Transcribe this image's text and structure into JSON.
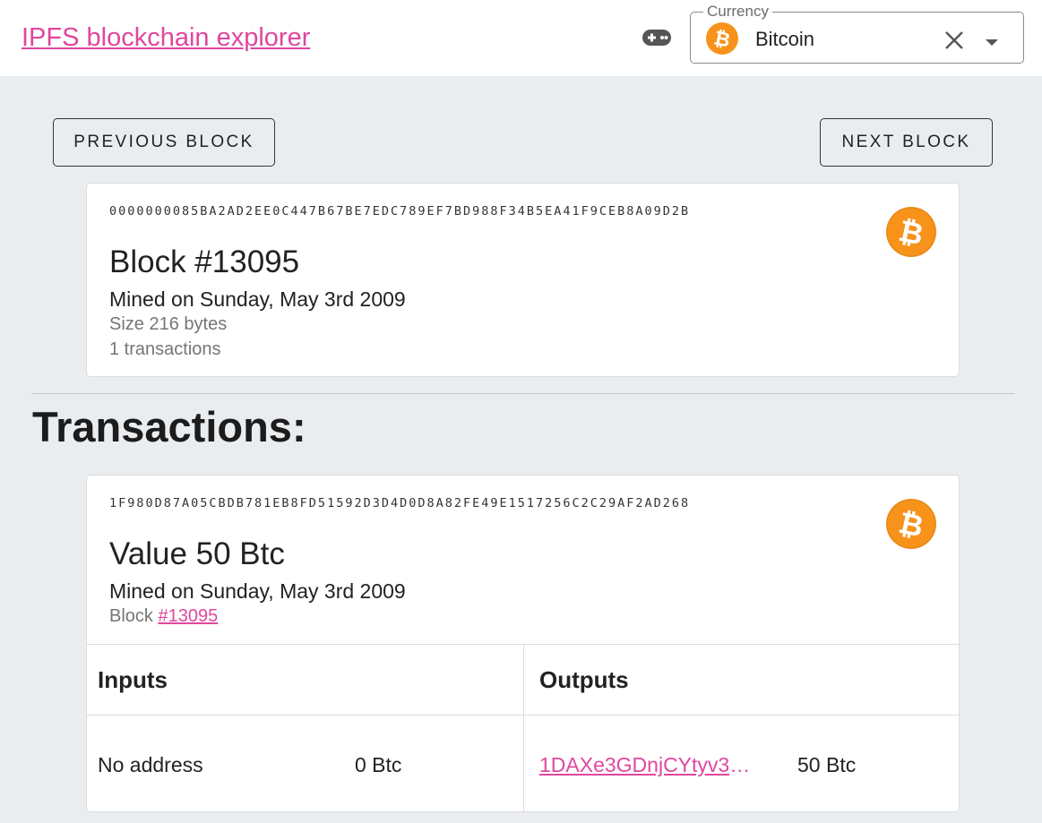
{
  "header": {
    "brand": "IPFS blockchain explorer",
    "game_icon": "gamepad-icon",
    "currency": {
      "legend": "Currency",
      "selected": "Bitcoin",
      "coin_icon": "bitcoin-icon",
      "clear_icon": "close-icon",
      "dropdown_icon": "caret-down-icon"
    }
  },
  "navigation": {
    "previous_label": "PREVIOUS BLOCK",
    "next_label": "NEXT BLOCK"
  },
  "block": {
    "hash": "0000000085BA2AD2EE0C447B67BE7EDC789EF7BD988F34B5EA41F9CEB8A09D2B",
    "title": "Block #13095",
    "mined": "Mined on Sunday, May 3rd 2009",
    "size": "Size 216 bytes",
    "transactions": "1 transactions"
  },
  "transactions_title": "Transactions:",
  "transactions": [
    {
      "hash": "1F980D87A05CBDB781EB8FD51592D3D4D0D8A82FE49E1517256C2C29AF2AD268",
      "title": "Value 50 Btc",
      "mined": "Mined on Sunday, May 3rd 2009",
      "block_prefix": "Block",
      "block_link": "#13095",
      "inputs_header": "Inputs",
      "outputs_header": "Outputs",
      "inputs": [
        {
          "address": "No address",
          "amount": "0 Btc"
        }
      ],
      "outputs": [
        {
          "address": "1DAXe3GDnjCYtyv3E…",
          "amount": "50 Btc"
        }
      ]
    }
  ],
  "colors": {
    "accent": "#e0479e",
    "background": "#eaedf0",
    "bitcoin_orange": "#f7931a"
  }
}
